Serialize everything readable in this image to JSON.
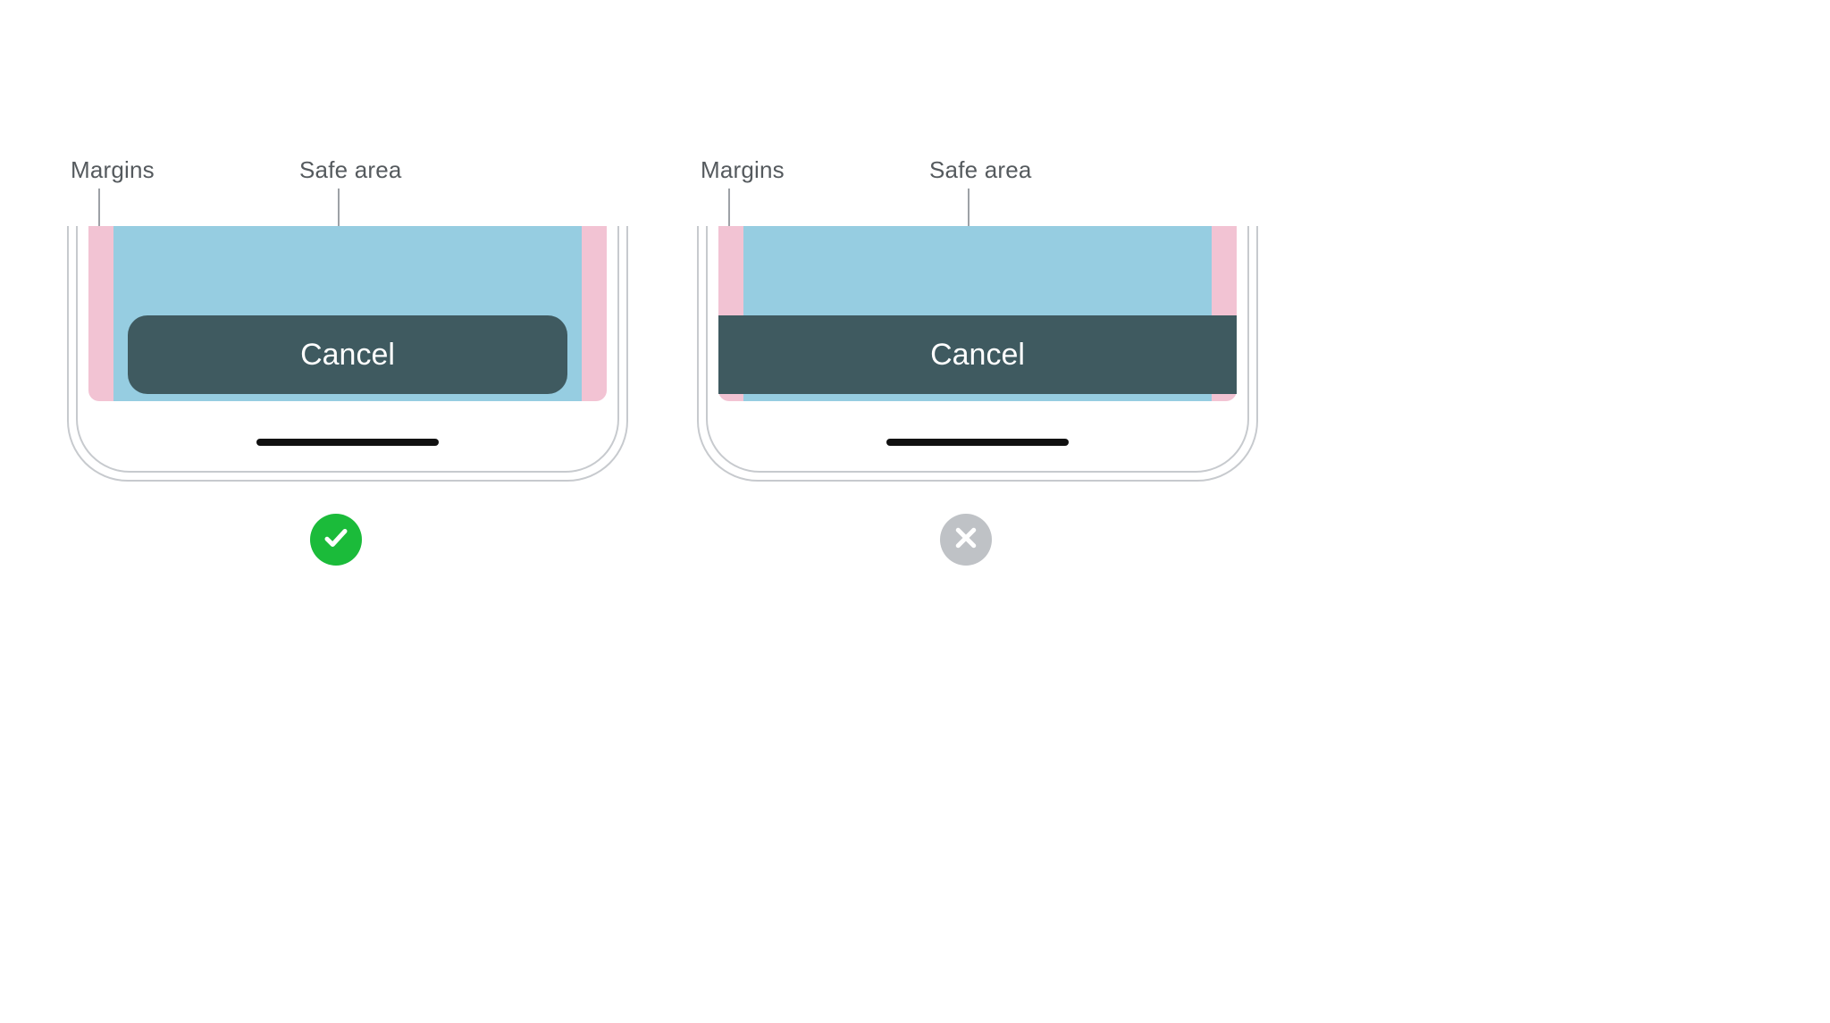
{
  "labels": {
    "margins": "Margins",
    "safe_area": "Safe area"
  },
  "examples": {
    "good": {
      "button_label": "Cancel"
    },
    "bad": {
      "button_label": "Cancel"
    }
  },
  "colors": {
    "margin": "#f2c3d3",
    "safe_area": "#96cde1",
    "button_bg": "#3f5a60",
    "button_text": "#ffffff",
    "good_badge": "#1bbb3a",
    "bad_badge": "#bfc2c6",
    "label_text": "#555a5e"
  }
}
